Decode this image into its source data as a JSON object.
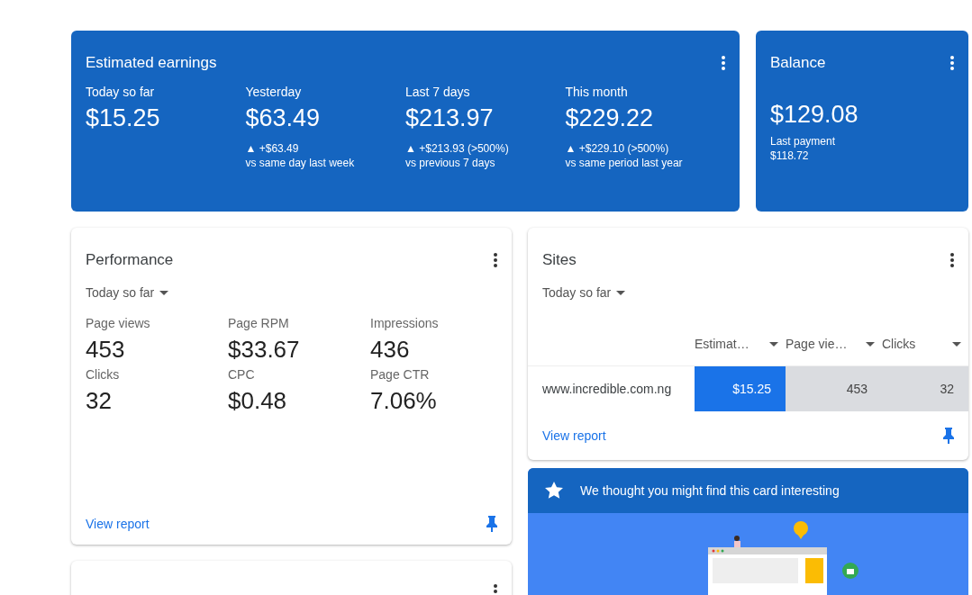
{
  "earnings": {
    "title": "Estimated earnings",
    "stats": [
      {
        "label": "Today so far",
        "value": "$15.25"
      },
      {
        "label": "Yesterday",
        "value": "$63.49",
        "change": "▲ +$63.49",
        "comparison": "vs same day last week"
      },
      {
        "label": "Last 7 days",
        "value": "$213.97",
        "change": "▲ +$213.93 (>500%)",
        "comparison": "vs previous 7 days"
      },
      {
        "label": "This month",
        "value": "$229.22",
        "change": "▲ +$229.10 (>500%)",
        "comparison": "vs same period last year"
      }
    ]
  },
  "balance": {
    "title": "Balance",
    "value": "$129.08",
    "last_payment_label": "Last payment",
    "last_payment_value": "$118.72"
  },
  "performance": {
    "title": "Performance",
    "period": "Today so far",
    "metrics": [
      {
        "label": "Page views",
        "value": "453"
      },
      {
        "label": "Page RPM",
        "value": "$33.67"
      },
      {
        "label": "Impressions",
        "value": "436"
      },
      {
        "label": "Clicks",
        "value": "32"
      },
      {
        "label": "CPC",
        "value": "$0.48"
      },
      {
        "label": "Page CTR",
        "value": "7.06%"
      }
    ],
    "link": "View report"
  },
  "sites": {
    "title": "Sites",
    "period": "Today so far",
    "columns": [
      {
        "label": "Estimat…",
        "selected": true
      },
      {
        "label": "Page vie…",
        "selected": false
      },
      {
        "label": "Clicks",
        "selected": false
      }
    ],
    "rows": [
      {
        "site": "www.incredible.com.ng",
        "cells": [
          "$15.25",
          "453",
          "32"
        ]
      }
    ],
    "link": "View report"
  },
  "suggestion": {
    "title": "We thought you might find this card interesting"
  }
}
